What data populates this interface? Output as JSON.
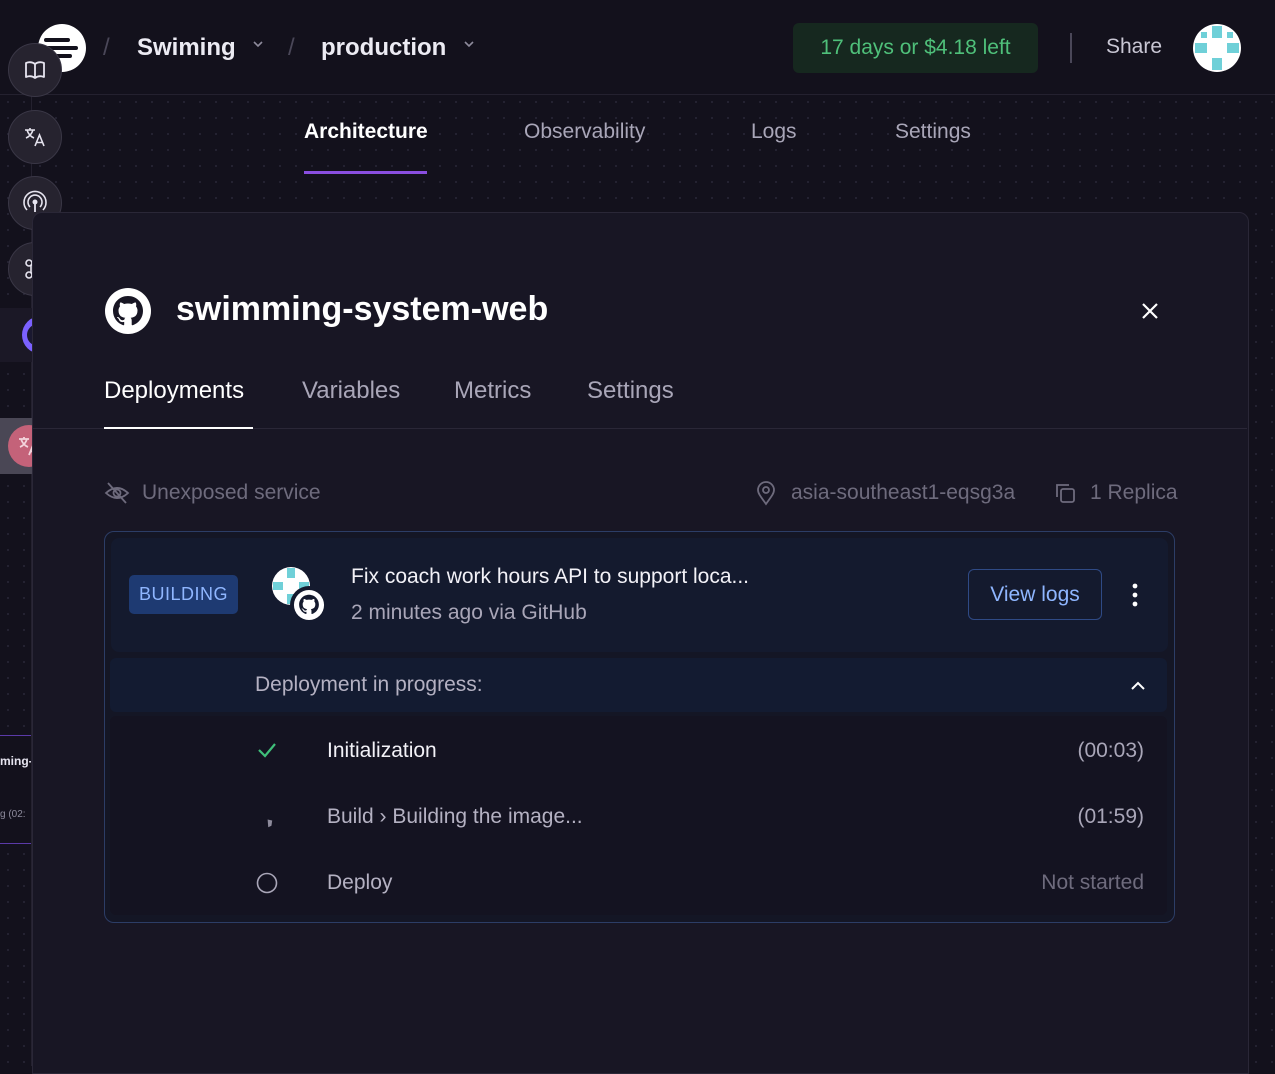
{
  "header": {
    "project_name": "Swiming",
    "environment_name": "production",
    "trial_text": "17 days or $4.18 left",
    "share_label": "Share"
  },
  "main_tabs": [
    {
      "label": "Architecture",
      "active": true
    },
    {
      "label": "Observability",
      "active": false
    },
    {
      "label": "Logs",
      "active": false
    },
    {
      "label": "Settings",
      "active": false
    }
  ],
  "dock": {
    "items": [
      "book-icon",
      "translate-icon",
      "broadcast-icon",
      "command-icon",
      "assistant-bot-icon"
    ],
    "floating_translate": "translate-icon"
  },
  "edge_card": {
    "title_fragment": "ming-",
    "subtitle_fragment": "g (02:"
  },
  "service": {
    "name": "swimming-system-web",
    "tabs": [
      {
        "label": "Deployments",
        "active": true
      },
      {
        "label": "Variables",
        "active": false
      },
      {
        "label": "Metrics",
        "active": false
      },
      {
        "label": "Settings",
        "active": false
      }
    ],
    "exposure": "Unexposed service",
    "region": "asia-southeast1-eqsg3a",
    "replicas": "1 Replica"
  },
  "deployment": {
    "status": "BUILDING",
    "commit_message": "Fix coach work hours API to support loca...",
    "commit_meta": "2 minutes ago via GitHub",
    "view_logs_label": "View logs",
    "progress_label": "Deployment in progress:",
    "steps": [
      {
        "name": "Initialization",
        "time": "(00:03)",
        "state": "done"
      },
      {
        "name": "Build › Building the image...",
        "time": "(01:59)",
        "state": "running"
      },
      {
        "name": "Deploy",
        "time": "Not started",
        "state": "pending"
      }
    ]
  },
  "colors": {
    "background": "#13111c",
    "accent_purple": "#8a4ee0",
    "trial_green": "#4fc07a",
    "badge_blue": "#1e3a72",
    "link_blue": "#8fb6ff",
    "success_green": "#3fbf7a"
  }
}
